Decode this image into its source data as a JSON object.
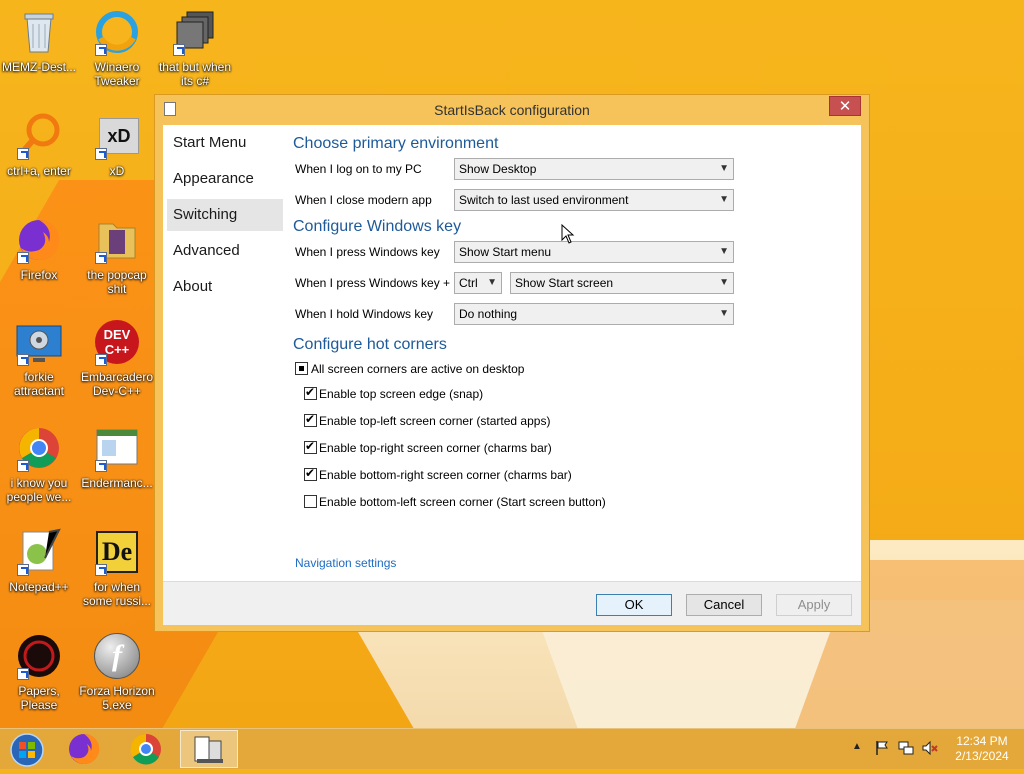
{
  "desktop": {
    "icons": [
      {
        "label": "MEMZ-Dest..."
      },
      {
        "label": "Winaero Tweaker"
      },
      {
        "label": "that but when its c#"
      },
      {
        "label": "ctrl+a, enter"
      },
      {
        "label": "xD"
      },
      {
        "label": "Firefox"
      },
      {
        "label": "the popcap shit"
      },
      {
        "label": "forkie attractant"
      },
      {
        "label": "Embarcadero Dev-C++"
      },
      {
        "label": "i know you people we..."
      },
      {
        "label": "Endermanc..."
      },
      {
        "label": "Notepad++"
      },
      {
        "label": "for when some russi..."
      },
      {
        "label": "Papers, Please"
      },
      {
        "label": "Forza Horizon 5.exe"
      }
    ],
    "icon_badges": {
      "xd": "xD",
      "devcpp": "DEV C++",
      "de": "De",
      "flash": "f"
    }
  },
  "dialog": {
    "title": "StartIsBack configuration",
    "close_glyph": "✕",
    "sidebar": [
      {
        "label": "Start Menu"
      },
      {
        "label": "Appearance"
      },
      {
        "label": "Switching"
      },
      {
        "label": "Advanced"
      },
      {
        "label": "About"
      }
    ],
    "selected_tab": "Switching",
    "primary_env": {
      "heading": "Choose primary environment",
      "logon_label": "When I log on to my PC",
      "logon_value": "Show Desktop",
      "close_label": "When I close modern app",
      "close_value": "Switch to last used environment"
    },
    "winkey": {
      "heading": "Configure Windows key",
      "press_label": "When I press Windows key",
      "press_value": "Show Start menu",
      "press_plus_label": "When I press Windows key +",
      "modifier_value": "Ctrl",
      "combo_value": "Show Start screen",
      "hold_label": "When I hold Windows key",
      "hold_value": "Do nothing"
    },
    "hot_corners": {
      "heading": "Configure hot corners",
      "all_label": "All screen corners are active on desktop",
      "options": [
        {
          "label": "Enable top screen edge (snap)",
          "checked": true
        },
        {
          "label": "Enable top-left screen corner (started apps)",
          "checked": true
        },
        {
          "label": "Enable top-right screen corner (charms bar)",
          "checked": true
        },
        {
          "label": "Enable bottom-right screen corner (charms bar)",
          "checked": true
        },
        {
          "label": "Enable bottom-left screen corner (Start screen button)",
          "checked": false
        }
      ]
    },
    "nav_link": "Navigation settings",
    "buttons": {
      "ok": "OK",
      "cancel": "Cancel",
      "apply": "Apply"
    },
    "arrow_glyph": "▼"
  },
  "taskbar": {
    "tray_chevron": "▲",
    "tray_icons": [
      "flag-icon",
      "network-icon",
      "volume-muted-icon"
    ],
    "clock_time": "12:34 PM",
    "clock_date": "2/13/2024"
  },
  "colors": {
    "desktop": "#f6b41c",
    "heading": "#1e5a9a",
    "link": "#1e6cc2",
    "close": "#c75050"
  }
}
